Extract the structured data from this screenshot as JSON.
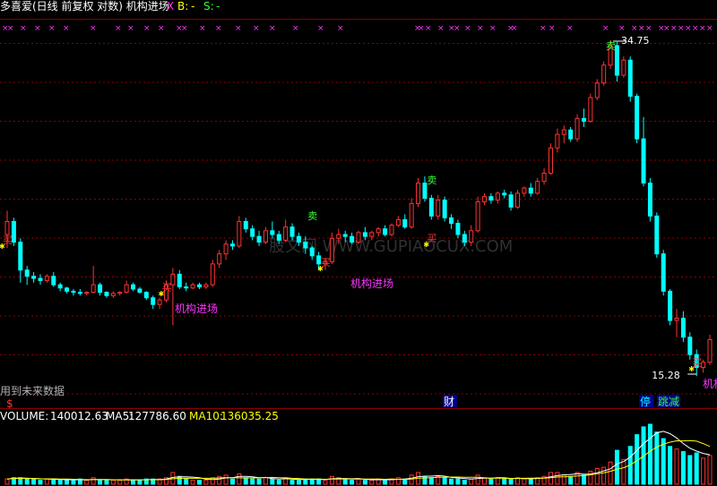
{
  "header": {
    "title": "多喜爱(日线 前复权 对数) 机构进场",
    "x_mark": "X",
    "b_label": "B:",
    "b_value": "-",
    "s_label": "S:",
    "s_value": "-"
  },
  "price_panel": {
    "high_label": "34.75",
    "low_label": "15.28",
    "annotation_text": "机构进场",
    "annotation_cut": "机构",
    "buy_glyph": "买",
    "sell_glyph": "卖",
    "future_data_note": "用到未来数据",
    "dollar_mark": "$",
    "cai_tag": "财",
    "ting_tag": "停",
    "zhuijian_tag": "跳减",
    "watermark": "股文网 WWW.GUPIAOCUX.COM"
  },
  "volume_panel": {
    "volume_label": "VOLUME:",
    "volume_value": "140012.63",
    "ma5_label": "MA5:",
    "ma5_value": "127786.60",
    "ma10_label": "MA10:",
    "ma10_value": "136035.25"
  },
  "colors": {
    "up": "#ff3232",
    "down": "#00ffff",
    "grid": "#8b0000",
    "magenta": "#ff33ff",
    "green": "#33ff33",
    "yellow": "#ffff00",
    "white": "#ffffff"
  },
  "chart_data": {
    "type": "candlestick",
    "scale": "log",
    "ohlc": [
      [
        21.6,
        22.9,
        20.9,
        22.3
      ],
      [
        22.3,
        22.5,
        21.0,
        21.2
      ],
      [
        21.2,
        21.4,
        19.2,
        19.8
      ],
      [
        19.8,
        20.0,
        19.1,
        19.5
      ],
      [
        19.5,
        19.7,
        19.2,
        19.4
      ],
      [
        19.4,
        19.6,
        19.1,
        19.3
      ],
      [
        19.3,
        19.6,
        19.2,
        19.5
      ],
      [
        19.5,
        19.7,
        19.0,
        19.1
      ],
      [
        19.1,
        19.2,
        18.8,
        18.95
      ],
      [
        18.95,
        19.0,
        18.7,
        18.8
      ],
      [
        18.8,
        18.9,
        18.6,
        18.75
      ],
      [
        18.75,
        18.9,
        18.6,
        18.7
      ],
      [
        18.7,
        18.8,
        18.6,
        18.75
      ],
      [
        18.75,
        20.0,
        18.7,
        19.1
      ],
      [
        19.1,
        19.2,
        18.6,
        18.75
      ],
      [
        18.75,
        18.8,
        18.5,
        18.6
      ],
      [
        18.6,
        18.8,
        18.5,
        18.7
      ],
      [
        18.7,
        18.8,
        18.6,
        18.75
      ],
      [
        18.75,
        19.3,
        18.7,
        19.1
      ],
      [
        19.1,
        19.2,
        18.8,
        18.9
      ],
      [
        18.9,
        19.0,
        18.7,
        18.75
      ],
      [
        18.75,
        18.8,
        18.4,
        18.5
      ],
      [
        18.5,
        18.6,
        18.0,
        18.2
      ],
      [
        18.2,
        18.5,
        18.0,
        18.4
      ],
      [
        18.4,
        19.3,
        18.3,
        19.1
      ],
      [
        19.1,
        19.9,
        17.3,
        19.6
      ],
      [
        19.6,
        19.8,
        18.9,
        19.0
      ],
      [
        19.0,
        19.2,
        18.8,
        18.95
      ],
      [
        18.95,
        19.2,
        18.9,
        19.1
      ],
      [
        19.1,
        19.2,
        18.9,
        19.0
      ],
      [
        19.0,
        19.2,
        18.9,
        19.1
      ],
      [
        19.1,
        20.3,
        19.0,
        20.1
      ],
      [
        20.1,
        20.8,
        19.9,
        20.6
      ],
      [
        20.6,
        21.3,
        20.3,
        21.1
      ],
      [
        21.1,
        21.3,
        20.8,
        21.0
      ],
      [
        21.0,
        22.6,
        20.9,
        22.3
      ],
      [
        22.3,
        22.5,
        21.7,
        21.9
      ],
      [
        21.9,
        22.1,
        21.3,
        21.5
      ],
      [
        21.5,
        21.8,
        21.0,
        21.2
      ],
      [
        21.2,
        22.0,
        21.1,
        21.8
      ],
      [
        21.8,
        22.3,
        21.4,
        21.6
      ],
      [
        21.6,
        21.8,
        21.1,
        21.3
      ],
      [
        21.3,
        22.4,
        21.2,
        22.0
      ],
      [
        22.0,
        22.2,
        21.3,
        21.5
      ],
      [
        21.5,
        21.7,
        21.0,
        21.2
      ],
      [
        21.2,
        21.5,
        20.6,
        20.9
      ],
      [
        20.9,
        21.0,
        20.3,
        20.5
      ],
      [
        20.5,
        20.7,
        19.8,
        20.1
      ],
      [
        20.1,
        20.4,
        19.8,
        20.2
      ],
      [
        20.2,
        21.7,
        20.1,
        21.4
      ],
      [
        21.4,
        21.9,
        21.1,
        21.6
      ],
      [
        21.6,
        21.8,
        21.2,
        21.5
      ],
      [
        21.5,
        21.7,
        21.1,
        21.2
      ],
      [
        21.2,
        21.8,
        21.1,
        21.7
      ],
      [
        21.7,
        22.0,
        21.3,
        21.5
      ],
      [
        21.5,
        21.8,
        21.3,
        21.7
      ],
      [
        21.7,
        22.0,
        21.5,
        21.9
      ],
      [
        21.9,
        22.1,
        21.5,
        21.6
      ],
      [
        21.6,
        22.2,
        21.5,
        22.1
      ],
      [
        22.1,
        22.6,
        22.0,
        22.4
      ],
      [
        22.4,
        22.7,
        21.9,
        22.0
      ],
      [
        22.0,
        23.6,
        21.9,
        23.3
      ],
      [
        23.3,
        24.8,
        23.1,
        24.5
      ],
      [
        24.5,
        24.9,
        23.4,
        23.6
      ],
      [
        23.6,
        23.8,
        22.4,
        22.6
      ],
      [
        22.6,
        23.8,
        22.4,
        23.5
      ],
      [
        23.5,
        23.7,
        22.3,
        22.5
      ],
      [
        22.5,
        22.7,
        21.9,
        22.2
      ],
      [
        22.2,
        22.4,
        21.4,
        21.6
      ],
      [
        21.6,
        21.8,
        21.0,
        21.2
      ],
      [
        21.2,
        22.1,
        21.0,
        21.8
      ],
      [
        21.8,
        23.7,
        21.7,
        23.4
      ],
      [
        23.4,
        23.9,
        23.2,
        23.7
      ],
      [
        23.7,
        23.9,
        23.3,
        23.5
      ],
      [
        23.5,
        24.0,
        23.3,
        23.9
      ],
      [
        23.9,
        24.1,
        23.6,
        23.8
      ],
      [
        23.8,
        24.0,
        22.9,
        23.1
      ],
      [
        23.1,
        24.1,
        23.0,
        23.9
      ],
      [
        23.9,
        24.3,
        23.7,
        24.2
      ],
      [
        24.2,
        24.5,
        23.7,
        23.9
      ],
      [
        23.9,
        24.8,
        23.8,
        24.6
      ],
      [
        24.6,
        25.4,
        24.4,
        25.1
      ],
      [
        25.1,
        27.0,
        25.0,
        26.7
      ],
      [
        26.7,
        28.0,
        26.4,
        27.6
      ],
      [
        27.6,
        28.2,
        27.0,
        27.9
      ],
      [
        27.9,
        28.1,
        27.1,
        27.3
      ],
      [
        27.3,
        29.0,
        27.1,
        28.7
      ],
      [
        28.7,
        29.4,
        28.1,
        28.5
      ],
      [
        28.5,
        30.5,
        28.4,
        30.2
      ],
      [
        30.2,
        31.6,
        30.0,
        31.3
      ],
      [
        31.3,
        33.0,
        31.1,
        32.7
      ],
      [
        32.7,
        34.75,
        32.4,
        34.3
      ],
      [
        34.3,
        34.6,
        31.4,
        31.9
      ],
      [
        31.9,
        33.4,
        31.7,
        33.1
      ],
      [
        33.1,
        33.4,
        29.9,
        30.3
      ],
      [
        30.3,
        30.5,
        27.0,
        27.3
      ],
      [
        27.3,
        28.8,
        24.3,
        24.5
      ],
      [
        24.5,
        24.8,
        22.3,
        22.6
      ],
      [
        22.6,
        22.8,
        20.4,
        20.6
      ],
      [
        20.6,
        20.8,
        18.6,
        18.8
      ],
      [
        18.8,
        18.9,
        17.3,
        17.5
      ],
      [
        17.5,
        18.0,
        16.8,
        17.6
      ],
      [
        17.6,
        17.9,
        16.6,
        16.8
      ],
      [
        16.8,
        17.0,
        15.9,
        16.1
      ],
      [
        16.1,
        16.3,
        15.28,
        15.6
      ],
      [
        15.6,
        15.9,
        15.4,
        15.8
      ],
      [
        15.8,
        16.9,
        15.7,
        16.7
      ]
    ],
    "volume": [
      4,
      5,
      5,
      4,
      4,
      3,
      4,
      4,
      3,
      3,
      3,
      4,
      3,
      5,
      3,
      3,
      3,
      3,
      4,
      3,
      3,
      4,
      4,
      4,
      5,
      9,
      6,
      4,
      3,
      3,
      3,
      5,
      6,
      7,
      4,
      8,
      5,
      4,
      4,
      5,
      4,
      3,
      5,
      3,
      3,
      4,
      4,
      4,
      3,
      6,
      5,
      4,
      3,
      4,
      3,
      3,
      4,
      3,
      4,
      5,
      4,
      7,
      9,
      6,
      5,
      6,
      5,
      4,
      4,
      3,
      4,
      7,
      5,
      4,
      5,
      4,
      4,
      5,
      4,
      4,
      5,
      6,
      9,
      9,
      7,
      6,
      9,
      7,
      10,
      12,
      13,
      17,
      26,
      19,
      29,
      38,
      44,
      46,
      40,
      35,
      29,
      27,
      25,
      22,
      24,
      20,
      22
    ],
    "ma_lines": [
      "MA5",
      "MA10"
    ]
  }
}
